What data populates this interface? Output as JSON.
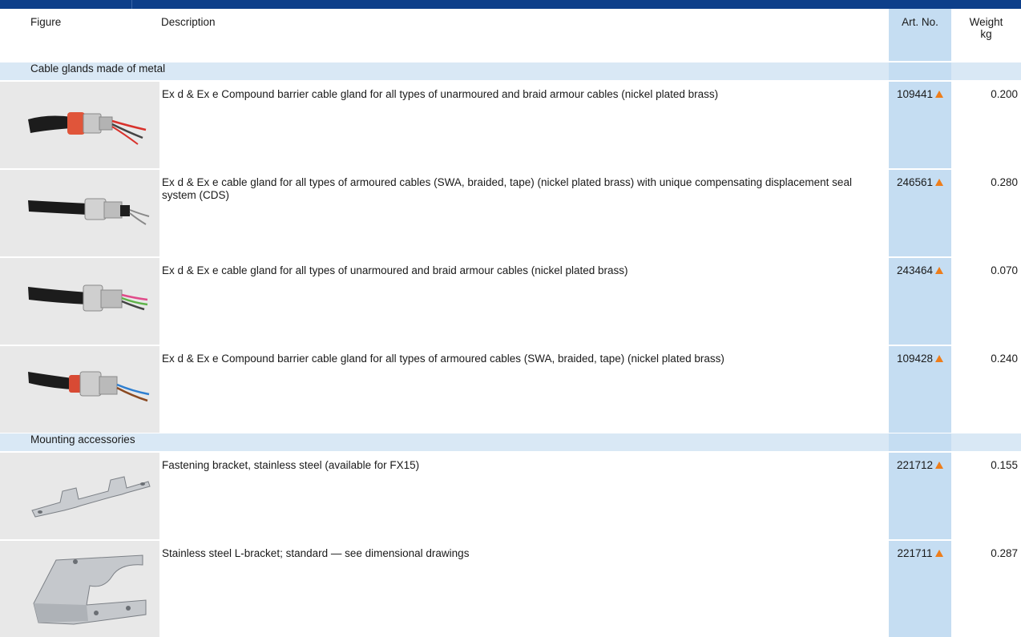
{
  "header": {
    "figure": "Figure",
    "description": "Description",
    "art_no": "Art. No.",
    "weight_line1": "Weight",
    "weight_line2": "kg"
  },
  "sections": [
    {
      "title": "Cable glands made of metal",
      "rows": [
        {
          "icon": "cable-gland-red-icon",
          "description": "Ex d & Ex e Compound barrier cable gland for all types of unarmoured and braid armour cables (nickel plated brass)",
          "art_no": "109441",
          "weight": "0.200"
        },
        {
          "icon": "cable-gland-armoured-icon",
          "description": "Ex d & Ex e cable gland for all types of armoured cables (SWA, braided, tape) (nickel plated brass) with unique compensating displacement seal system (CDS)",
          "art_no": "246561",
          "weight": "0.280"
        },
        {
          "icon": "cable-gland-unarmoured-icon",
          "description": "Ex d & Ex e cable gland for all types of unarmoured and braid armour cables (nickel plated brass)",
          "art_no": "243464",
          "weight": "0.070"
        },
        {
          "icon": "cable-gland-compound-icon",
          "description": "Ex d & Ex e Compound barrier cable gland for all types of armoured cables (SWA, braided, tape) (nickel plated brass)",
          "art_no": "109428",
          "weight": "0.240"
        }
      ]
    },
    {
      "title": "Mounting accessories",
      "rows": [
        {
          "icon": "fastening-bracket-icon",
          "description": "Fastening bracket, stainless steel (available for FX15)",
          "art_no": "221712",
          "weight": "0.155"
        },
        {
          "icon": "l-bracket-icon",
          "description": "Stainless steel L-bracket; standard — see dimensional drawings",
          "art_no": "221711",
          "weight": "0.287"
        }
      ]
    }
  ],
  "colors": {
    "header_bar": "#0d3f8a",
    "section_band": "#d9e8f5",
    "art_column": "#c5ddf2",
    "figure_bg": "#e8e8e8",
    "marker": "#ee7d1a"
  }
}
